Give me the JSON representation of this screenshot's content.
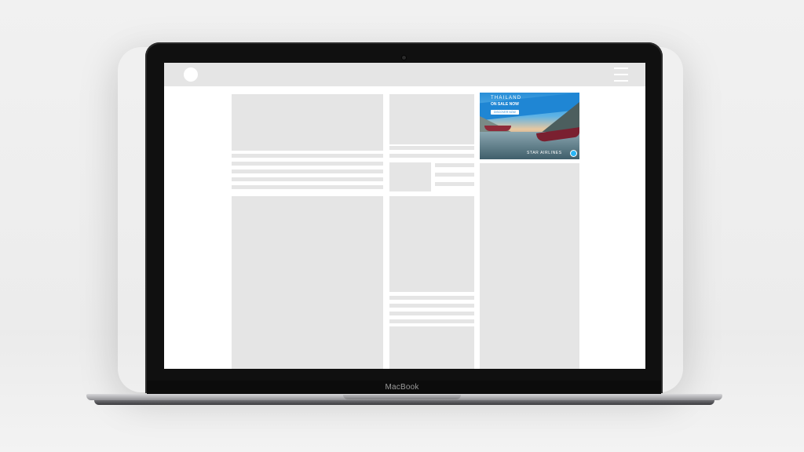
{
  "device": {
    "brand": "MacBook"
  },
  "header": {
    "logo": "circle-logo",
    "menu_icon": "hamburger-menu-icon"
  },
  "ad": {
    "title": "THAILAND",
    "subtitle": "ON SALE NOW",
    "button_label": "DISCOVER NOW",
    "brand": "STAR AIRLINES"
  },
  "colors": {
    "placeholder": "#e5e5e5",
    "ad_blue": "#1f86d4",
    "bezel": "#101010"
  }
}
